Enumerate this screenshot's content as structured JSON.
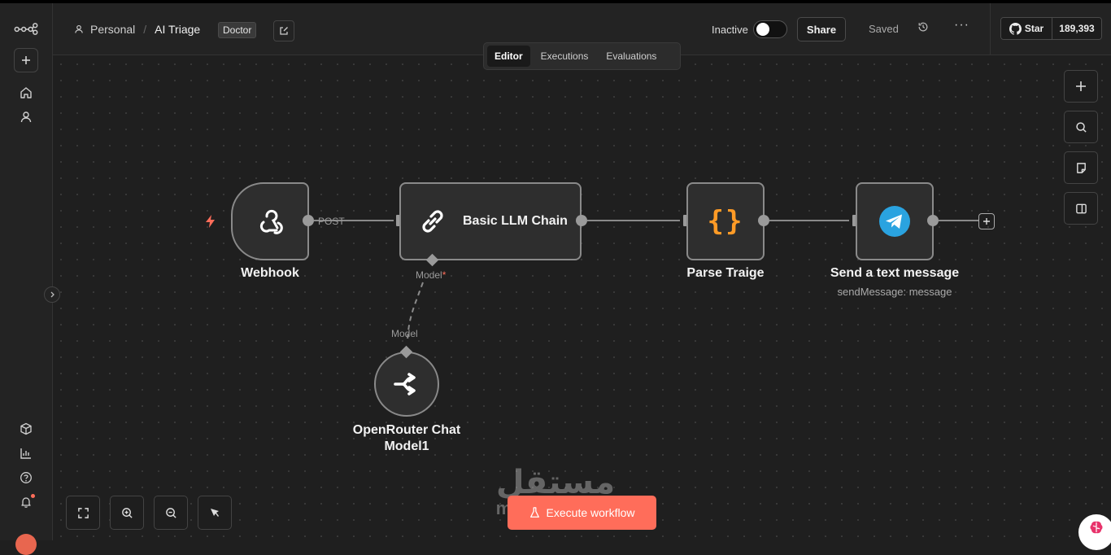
{
  "app": {
    "logo_icon": "n8n-logo-icon"
  },
  "sidebar": {
    "items": [
      {
        "name": "home",
        "icon": "home-icon"
      },
      {
        "name": "personal",
        "icon": "user-icon"
      },
      {
        "name": "templates",
        "icon": "box-icon"
      },
      {
        "name": "insights",
        "icon": "chart-icon"
      },
      {
        "name": "help",
        "icon": "help-icon"
      },
      {
        "name": "notifications",
        "icon": "bell-icon"
      }
    ],
    "add_icon": "plus-icon"
  },
  "header": {
    "project": "Personal",
    "workflow_name": "AI Triage",
    "tag": "Doctor",
    "status_label": "Inactive",
    "share_label": "Share",
    "saved_label": "Saved",
    "more_label": "···"
  },
  "github": {
    "star_label": "Star",
    "count": "189,393"
  },
  "tabs": [
    {
      "label": "Editor",
      "active": true
    },
    {
      "label": "Executions",
      "active": false
    },
    {
      "label": "Evaluations",
      "active": false
    }
  ],
  "nodes": {
    "webhook": {
      "label": "Webhook",
      "output_label": "POST",
      "icon": "webhook-icon"
    },
    "llm_chain": {
      "label": "Basic LLM Chain",
      "model_port_label": "Model",
      "required_mark": "*",
      "icon": "link-icon"
    },
    "parse": {
      "label": "Parse Traige",
      "icon_text": "{}"
    },
    "telegram": {
      "label": "Send a text message",
      "subtitle": "sendMessage: message",
      "icon": "telegram-icon"
    },
    "openrouter": {
      "label_line1": "OpenRouter Chat",
      "label_line2": "Model1",
      "port_label": "Model",
      "icon": "openrouter-icon"
    }
  },
  "canvas": {
    "execute_label": "Execute workflow",
    "watermark_arabic": "مستقل",
    "watermark_latin": "mostaql.com"
  },
  "colors": {
    "accent": "#ff6d5a",
    "parse_icon": "#ff9b26",
    "telegram": "#2aa3e0"
  }
}
